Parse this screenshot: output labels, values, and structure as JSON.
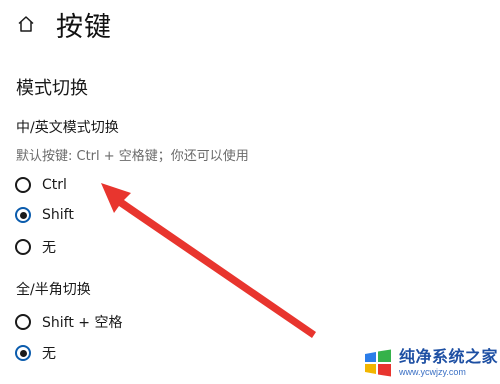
{
  "header": {
    "title": "按键",
    "home_icon": "home-icon"
  },
  "section": {
    "title": "模式切换"
  },
  "lang_switch": {
    "label": "中/英文模式切换",
    "hint": "默认按键: Ctrl + 空格键；你还可以使用",
    "options": [
      {
        "label": "Ctrl",
        "checked": false
      },
      {
        "label": "Shift",
        "checked": true
      },
      {
        "label": "无",
        "checked": false
      }
    ]
  },
  "width_switch": {
    "label": "全/半角切换",
    "options": [
      {
        "label": "Shift + 空格",
        "checked": false
      },
      {
        "label": "无",
        "checked": true
      }
    ]
  },
  "annotation": {
    "color": "#e8352e",
    "points_to": "Ctrl option"
  },
  "watermark": {
    "title": "纯净系统之家",
    "url": "www.ycwjzy.com"
  }
}
